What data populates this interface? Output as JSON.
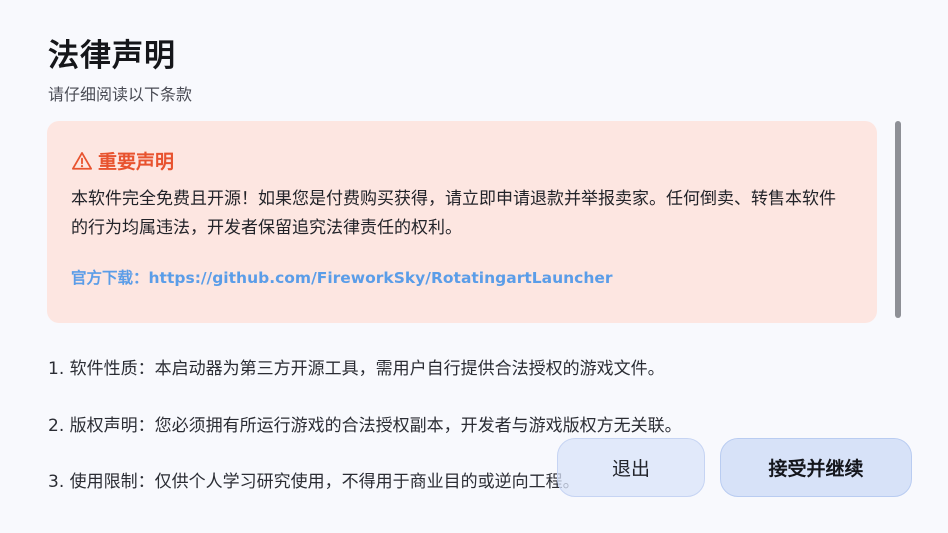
{
  "header": {
    "title": "法律声明",
    "subtitle": "请仔细阅读以下条款"
  },
  "notice": {
    "icon": "warning-triangle-icon",
    "heading": "重要声明",
    "body": "本软件完全免费且开源！如果您是付费购买获得，请立即申请退款并举报卖家。任何倒卖、转售本软件的行为均属违法，开发者保留追究法律责任的权利。",
    "download_label": "官方下载：",
    "download_url": "https://github.com/FireworkSky/RotatingartLauncher",
    "colors": {
      "background": "#fde6e1",
      "heading": "#e8532f",
      "link": "#5b9de8"
    }
  },
  "terms": [
    "1. 软件性质：本启动器为第三方开源工具，需用户自行提供合法授权的游戏文件。",
    "2. 版权声明：您必须拥有所运行游戏的合法授权副本，开发者与游戏版权方无关联。",
    "3. 使用限制：仅供个人学习研究使用，不得用于商业目的或逆向工程。"
  ],
  "actions": {
    "exit_label": "退出",
    "accept_label": "接受并继续"
  }
}
